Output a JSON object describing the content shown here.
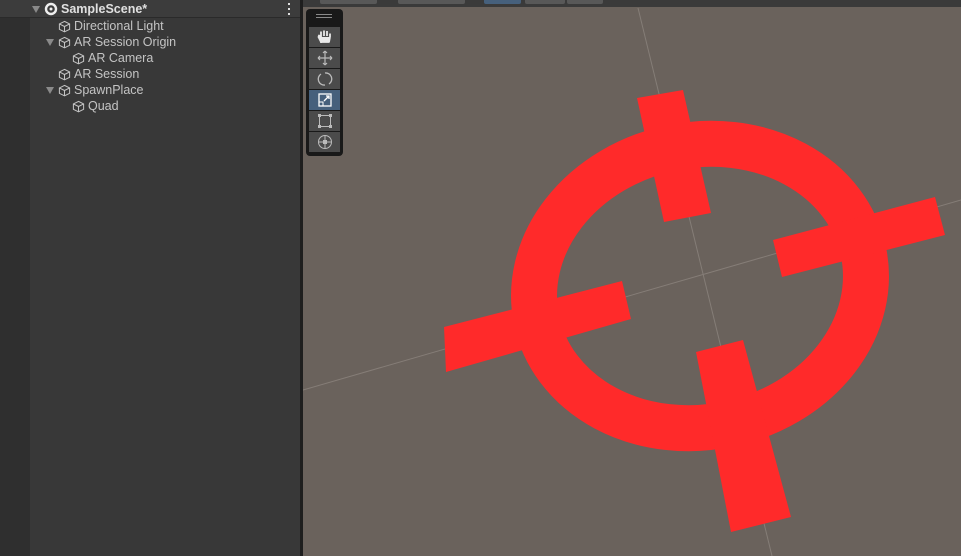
{
  "hierarchy": {
    "scene": "SampleScene*",
    "items": [
      {
        "label": "Directional Light",
        "depth": 1,
        "expandable": false
      },
      {
        "label": "AR Session Origin",
        "depth": 1,
        "expandable": true
      },
      {
        "label": "AR Camera",
        "depth": 2,
        "expandable": false
      },
      {
        "label": "AR Session",
        "depth": 1,
        "expandable": false
      },
      {
        "label": "SpawnPlace",
        "depth": 1,
        "expandable": true
      },
      {
        "label": "Quad",
        "depth": 2,
        "expandable": false
      }
    ]
  },
  "tools": [
    {
      "name": "hand-tool",
      "icon": "hand-icon"
    },
    {
      "name": "move-tool",
      "icon": "move-icon"
    },
    {
      "name": "rotate-tool",
      "icon": "rotate-icon"
    },
    {
      "name": "scale-tool",
      "icon": "scale-icon",
      "active": true
    },
    {
      "name": "rect-tool",
      "icon": "rect-icon"
    },
    {
      "name": "transform-tool",
      "icon": "transform-icon"
    }
  ],
  "colors": {
    "crosshair": "#ff2a2a",
    "scene_bg": "#6a625c",
    "active_tool": "#46607c"
  }
}
